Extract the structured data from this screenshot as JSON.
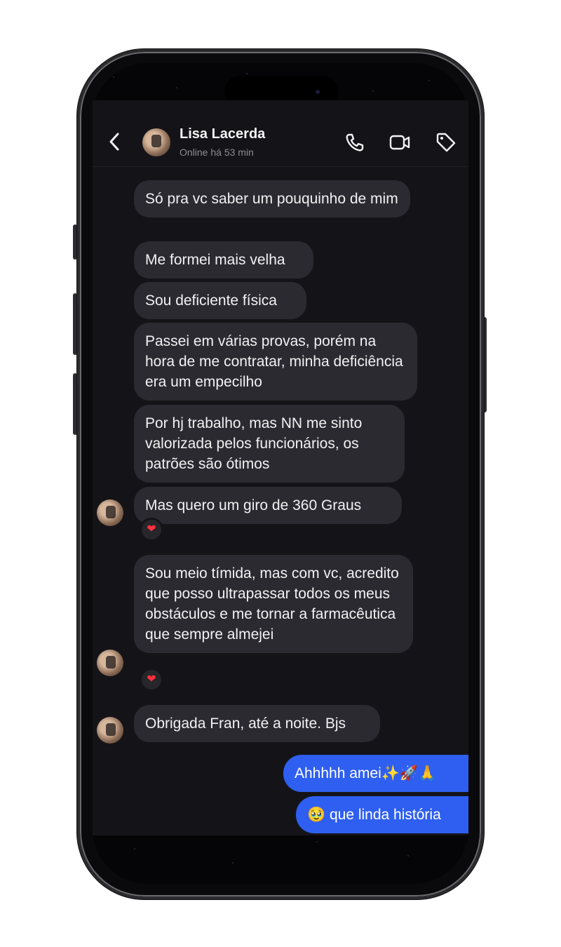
{
  "contact": {
    "name": "Lisa Lacerda",
    "status": "Online há 53 min"
  },
  "icons": {
    "back": "chevron-left-icon",
    "call": "phone-icon",
    "video": "video-camera-icon",
    "tag": "tag-icon"
  },
  "messages_in": [
    "Só pra vc saber um pouquinho de mim",
    "Me formei mais velha",
    "Sou deficiente física",
    "Passei em várias provas, porém na hora de me contratar, minha deficiência era um empecilho",
    "Por hj trabalho, mas NN me sinto valorizada pelos funcionários, os patrões são ótimos",
    "Mas quero um giro de 360 Graus",
    "Sou meio tímida, mas com vc, acredito que posso ultrapassar todos os meus obstáculos e me tornar a farmacêutica que sempre almejei",
    "Obrigada Fran, até a noite. Bjs"
  ],
  "messages_out": [
    "Ahhhhh amei✨🚀🙏",
    "🥹 que linda história"
  ],
  "reactions": [
    "❤",
    "❤"
  ],
  "colors": {
    "background": "#141418",
    "incoming_bubble": "#2a2a30",
    "outgoing_bubble": "#2f5ff0",
    "reaction": "#ff3040"
  }
}
